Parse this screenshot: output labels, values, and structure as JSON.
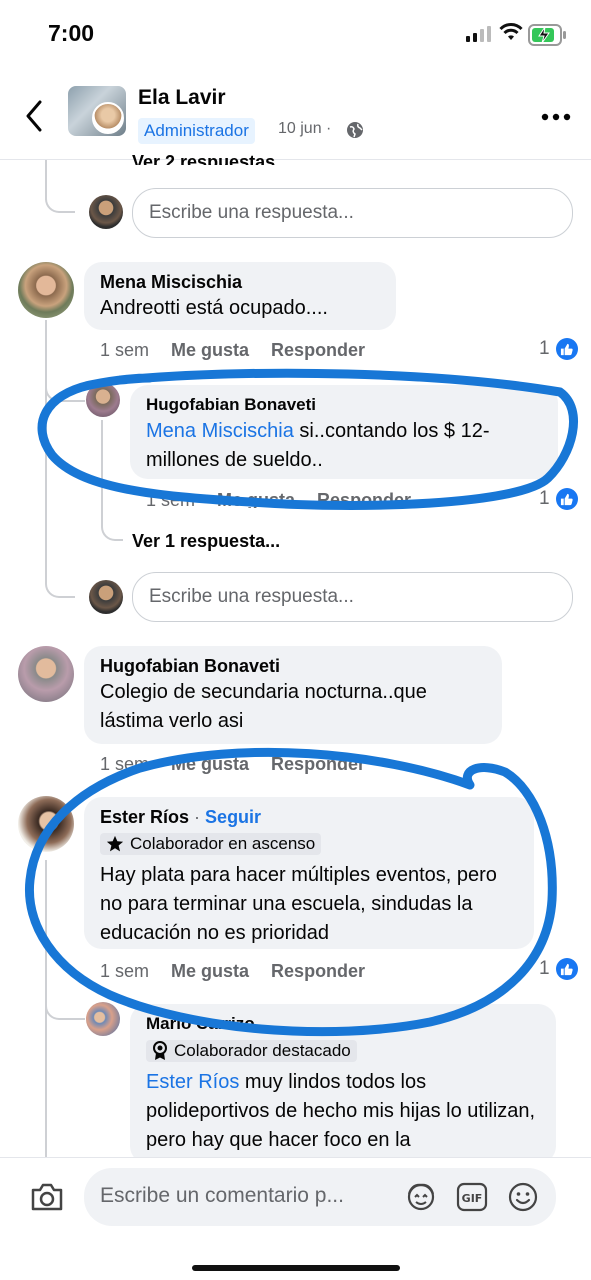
{
  "status_bar": {
    "time": "7:00"
  },
  "header": {
    "name": "Ela Lavir",
    "role_badge": "Administrador",
    "date": "10 jun · "
  },
  "thread_top": {
    "truncated_link": "Ver 2 respuestas...",
    "reply_placeholder": "Escribe una respuesta..."
  },
  "comments": [
    {
      "author": "Mena Miscischia",
      "text": "Andreotti está  ocupado....",
      "time": "1 sem",
      "like": "Me gusta",
      "reply": "Responder",
      "reactions": "1",
      "replies": [
        {
          "author": "Hugofabian Bonaveti",
          "mention": "Mena Miscischia",
          "text": " si..contando los $ 12-millones de sueldo..",
          "time": "1 sem",
          "like": "Me gusta",
          "reply": "Responder",
          "reactions": "1"
        }
      ],
      "more_replies": "Ver 1 respuesta...",
      "reply_placeholder": "Escribe una respuesta..."
    },
    {
      "author": "Hugofabian Bonaveti",
      "text": "Colegio de secundaria nocturna..que lástima verlo asi",
      "time": "1 sem",
      "like": "Me gusta",
      "reply": "Responder"
    },
    {
      "author": "Ester Ríos",
      "separator": " · ",
      "follow": "Seguir",
      "badge": "Colaborador en ascenso",
      "text": "Hay plata para hacer  múltiples eventos, pero no para terminar una escuela, sindudas la educación no es prioridad",
      "time": "1 sem",
      "like": "Me gusta",
      "reply": "Responder",
      "reactions": "1",
      "replies": [
        {
          "author": "Mario Carrizo",
          "badge": "Colaborador destacado",
          "mention": "Ester Ríos",
          "text": " muy lindos todos los polideportivos de hecho mis hijas lo utilizan, pero hay que hacer foco en la"
        }
      ]
    }
  ],
  "composer": {
    "placeholder": "Escribe un comentario p..."
  },
  "icons": [
    "back-chevron",
    "globe",
    "more-dots",
    "camera",
    "avatar-sticker",
    "gif",
    "emoji",
    "like-thumb",
    "star",
    "medal"
  ],
  "colors": {
    "accent": "#1b74e4",
    "annotation": "#1877d6",
    "bubble": "#f0f2f5"
  }
}
